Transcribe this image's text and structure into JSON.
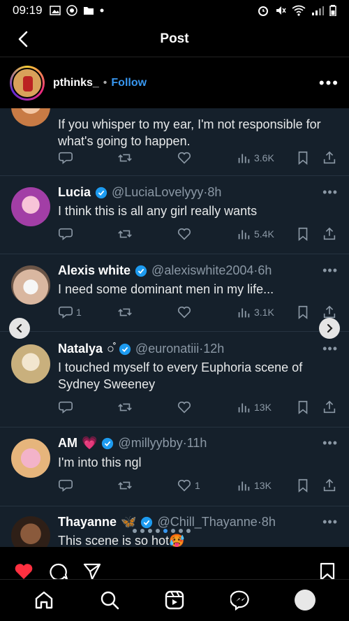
{
  "status_bar": {
    "time": "09:19"
  },
  "header": {
    "title": "Post"
  },
  "post": {
    "username": "pthinks_",
    "separator": "•",
    "follow_label": "Follow",
    "more": "•••"
  },
  "tweets": [
    {
      "text": "If you whisper to my ear, I'm not responsible for what's going to happen.",
      "views": "3.6K"
    },
    {
      "name": "Lucia",
      "handle": "@LuciaLovelyyy",
      "time": "·8h",
      "text": "I think this is all any girl really wants",
      "views": "5.4K"
    },
    {
      "name": "Alexis white",
      "handle": "@alexiswhite2004",
      "time": "·6h",
      "text": "I need some dominant men in my life...",
      "replies": "1",
      "views": "3.1K"
    },
    {
      "name": "Natalya",
      "emoji": "○̊",
      "handle": "@euronatiii",
      "time": "·12h",
      "text": "I touched myself to every Euphoria scene of Sydney Sweeney",
      "views": "13K"
    },
    {
      "name": "AM",
      "emoji": "💗",
      "handle": "@millyybby",
      "time": "·11h",
      "text": "I'm into this ngl",
      "likes": "1",
      "views": "13K"
    },
    {
      "name": "Thayanne",
      "emoji": "🦋",
      "handle": "@Chill_Thayanne",
      "time": "·8h",
      "text": "This scene is so hot🥵"
    }
  ],
  "icons": {
    "back": "chevron-left-icon",
    "reply": "speech-bubble-icon",
    "retweet": "retweet-icon",
    "like": "heart-icon",
    "views": "bar-chart-icon",
    "bookmark": "bookmark-icon",
    "share": "share-icon",
    "home": "home-icon",
    "search": "search-icon",
    "reels": "reels-icon",
    "messenger": "messenger-icon"
  },
  "colors": {
    "accent": "#3897f0",
    "feed_bg": "#15202b",
    "verified": "#1d9bf0",
    "like_active": "#ff3040"
  },
  "carousel": {
    "slide_count": 8,
    "active_index": 4
  }
}
